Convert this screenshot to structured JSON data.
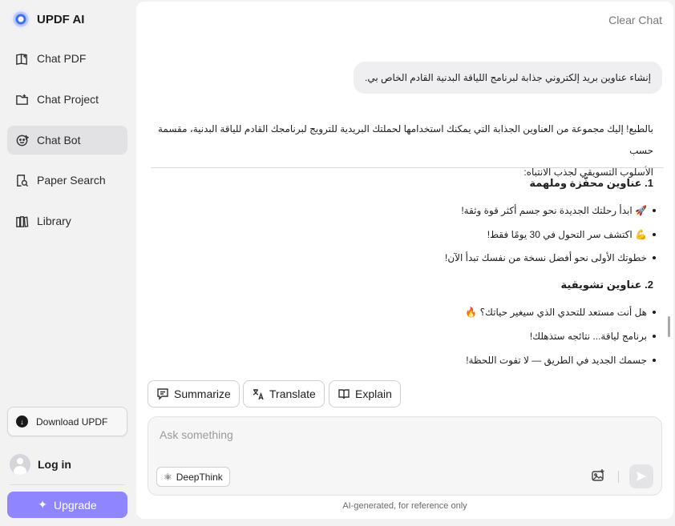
{
  "sidebar": {
    "brand": "UPDF AI",
    "items": [
      {
        "label": "Chat PDF",
        "icon": "book-icon"
      },
      {
        "label": "Chat Project",
        "icon": "folder-icon"
      },
      {
        "label": "Chat Bot",
        "icon": "bot-icon"
      },
      {
        "label": "Paper Search",
        "icon": "search-doc-icon"
      },
      {
        "label": "Library",
        "icon": "library-icon"
      }
    ],
    "active_index": 2,
    "download_label": "Download UPDF",
    "login_label": "Log in",
    "upgrade_label": "Upgrade"
  },
  "header": {
    "clear_chat": "Clear Chat"
  },
  "conversation": {
    "user_message": "إنشاء عناوين بريد إلكتروني جذابة لبرنامج اللياقة البدنية القادم الخاص بي.",
    "intro_line1": "بالطبع! إليك مجموعة من العناوين الجذابة التي يمكنك استخدامها لحملتك البريدية للترويج لبرنامجك القادم للياقة البدنية، مقسمة حسب",
    "intro_line2": "الأسلوب التسويقي لجذب الانتباه:",
    "section1": {
      "heading": "1. عناوين محفّزة وملهمة",
      "bullets": [
        "🚀 ابدأ رحلتك الجديدة نحو جسم أكثر قوة وثقة!",
        "💪 اكتشف سر التحول في 30 يومًا فقط!",
        "خطوتك الأولى نحو أفضل نسخة من نفسك تبدأ الآن!"
      ]
    },
    "section2": {
      "heading": "2. عناوين تشويقية",
      "bullets": [
        "هل أنت مستعد للتحدي الذي سيغير حياتك؟ 🔥",
        "برنامج لياقة... نتائجه ستذهلك!",
        "جسمك الجديد في الطريق — لا تفوت اللحظة!"
      ]
    }
  },
  "actions": {
    "summarize": "Summarize",
    "translate": "Translate",
    "explain": "Explain"
  },
  "input": {
    "placeholder": "Ask something",
    "deepthink": "DeepThink"
  },
  "footnote": "AI-generated, for reference only",
  "colors": {
    "upgrade": "#8f86ff",
    "active_nav": "#e2e2e5"
  }
}
